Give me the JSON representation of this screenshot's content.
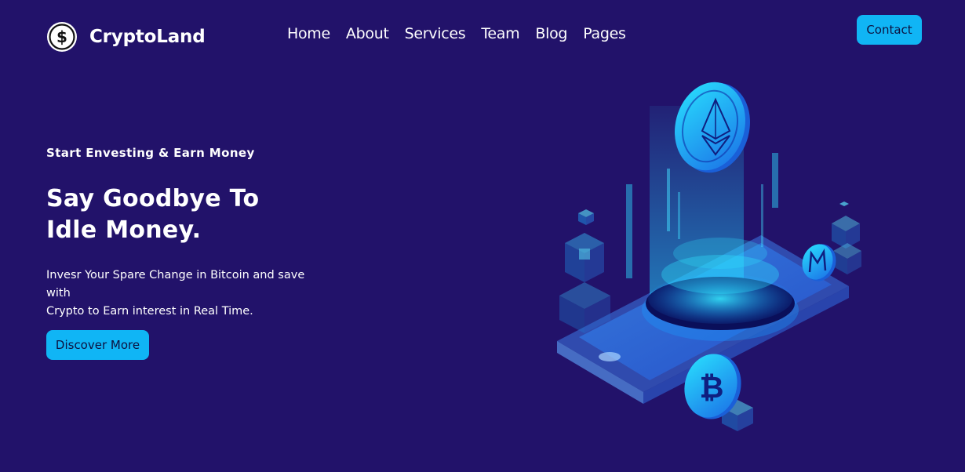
{
  "brand": {
    "name": "CryptoLand",
    "logo_icon": "dollar-coin-icon"
  },
  "nav": {
    "items": [
      {
        "label": "Home"
      },
      {
        "label": "About"
      },
      {
        "label": "Services"
      },
      {
        "label": "Team"
      },
      {
        "label": "Blog"
      },
      {
        "label": "Pages"
      }
    ]
  },
  "header": {
    "contact_label": "Contact"
  },
  "hero": {
    "eyebrow": "Start Envesting & Earn Money",
    "headline_line1": "Say Goodbye To",
    "headline_line2": "Idle Money.",
    "subtext_line1": "Invesr Your Spare Change in Bitcoin and save with",
    "subtext_line2": "Crypto to Earn interest in Real Time.",
    "cta_label": "Discover More"
  },
  "illustration": {
    "name": "isometric-crypto-phone-illustration",
    "coins": [
      "ethereum-coin-icon",
      "bitcoin-coin-icon",
      "monero-coin-icon"
    ]
  },
  "colors": {
    "background": "#22126a",
    "accent": "#10b5f5",
    "button_text": "#0d1240",
    "text": "#ffffff"
  }
}
